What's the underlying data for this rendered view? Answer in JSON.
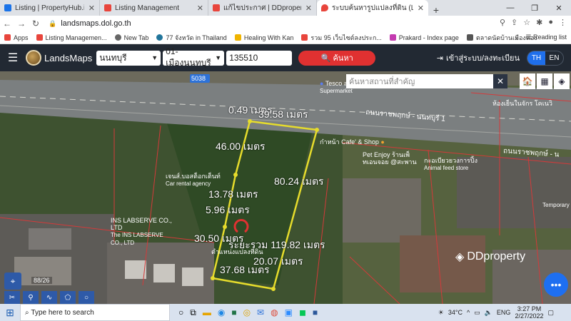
{
  "browser": {
    "tabs": [
      {
        "label": "Listing | PropertyHub.in.th",
        "color": "#1a73e8",
        "active": false
      },
      {
        "label": "Listing Management",
        "color": "#e8453c",
        "active": false
      },
      {
        "label": "แก้ไขประกาศ | DDproperty",
        "color": "#e8453c",
        "active": false
      },
      {
        "label": "ระบบค้นหารูปแปลงที่ดิน (LandsMaps)",
        "color": "#e8453c",
        "active": true
      }
    ],
    "newtab": "+",
    "url": "landsmaps.dol.go.th",
    "bookmarks": [
      {
        "label": "Apps",
        "color": "#e8453c"
      },
      {
        "label": "Listing Managemen...",
        "color": "#e8453c"
      },
      {
        "label": "New Tab",
        "color": "#666666"
      },
      {
        "label": "77 จังหวัด in Thailand",
        "color": "#21759b"
      },
      {
        "label": "Healing With Kan",
        "color": "#f0b400"
      },
      {
        "label": "รวม 95 เว็บไซต์ลงประก...",
        "color": "#e8453c"
      },
      {
        "label": "Prakard - Index page",
        "color": "#c43bb0"
      },
      {
        "label": "ตลาดนัดบ้านเมืองทอง",
        "color": "#555555"
      }
    ],
    "bookmarks_more": "»",
    "reading_list": "Reading list"
  },
  "app": {
    "brand": "LandsMaps",
    "province": "นนทบุรี",
    "district": "01-เมืองนนทบุรี",
    "parcel_no": "135510",
    "search_label": "ค้นหา",
    "login_label": "เข้าสู่ระบบ/ลงทะเบียน",
    "lang": {
      "th": "TH",
      "en": "EN"
    }
  },
  "map": {
    "search_placeholder": "ค้นหาสถานที่สำคัญ",
    "clear": "✕",
    "tools": [
      "🏠",
      "▦",
      "◈"
    ],
    "road_label_1": "ถนนราชพฤกษ์ - นนทบุรี 1",
    "road_label_2": "ถนนราชพฤกษ์ - น",
    "road_badge": "5038",
    "measures": [
      {
        "label": "0.49 เมตร"
      },
      {
        "label": "39.58 เมตร"
      },
      {
        "label": "46.00 เมตร"
      },
      {
        "label": "80.24 เมตร"
      },
      {
        "label": "13.78 เมตร"
      },
      {
        "label": "5.96 เมตร"
      },
      {
        "label": "30.50 เมตร"
      },
      {
        "label": "ระยะรวม  119.82 เมตร"
      },
      {
        "label": "20.07 เมตร"
      },
      {
        "label": "37.68 เมตร"
      }
    ],
    "pois": [
      {
        "label": "Tesco สาขาราชพฤกษ์",
        "sub": "Supermarket"
      },
      {
        "label": "ห้องเย็นในจักร โคเนวิ",
        "sub": ""
      },
      {
        "label": "ก๋าหน้า Cafe' & Shop",
        "sub": ""
      },
      {
        "label": "Pet Enjoy ร้านเพ็",
        "sub": "ทเอนจอย @สะพาน"
      },
      {
        "label": "กะอเบียวยวงการปิ้ง",
        "sub": "Animal feed store"
      },
      {
        "label": "เจนส์.บอสต็อกเต็นท์",
        "sub": "Car rental agency"
      },
      {
        "label": "INS LABSERVE CO., LTD",
        "sub": "The INS LABSERVE CO., LTD"
      },
      {
        "label": "ตำแหน่งแปลงที่ดิน",
        "sub": ""
      },
      {
        "label": "Temporary",
        "sub": ""
      }
    ],
    "scale": "88/26",
    "watermark": "DDproperty"
  },
  "taskbar": {
    "search_placeholder": "Type here to search",
    "weather": "34°C",
    "lang": "ENG",
    "time": "3:27 PM",
    "date": "2/27/2022"
  }
}
